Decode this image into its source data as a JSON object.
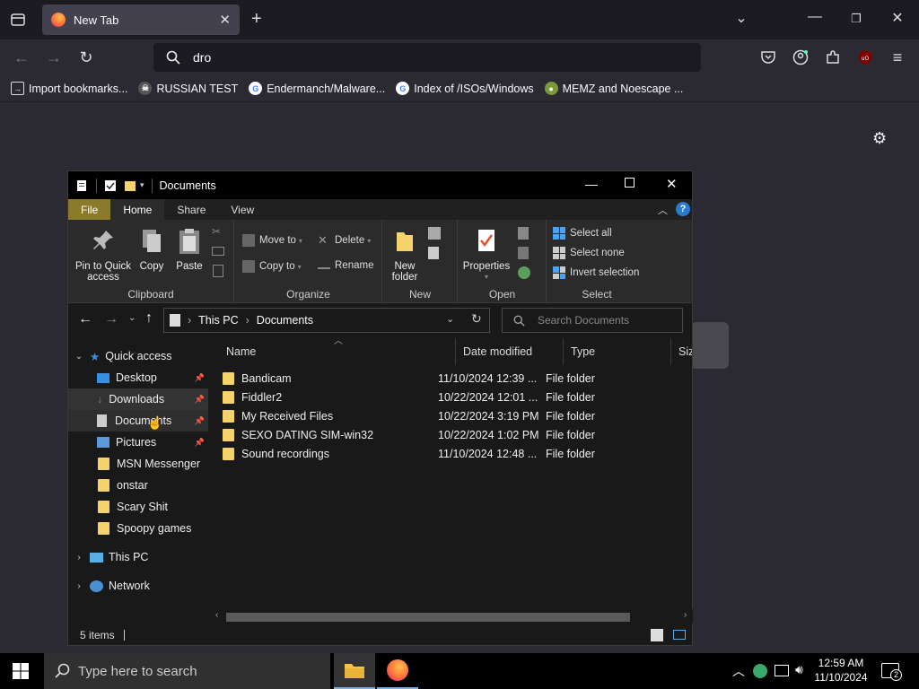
{
  "browser": {
    "tab_title": "New Tab",
    "url_text": "dro",
    "bookmarks": [
      "Import bookmarks...",
      "RUSSIAN TEST",
      "Endermanch/Malware...",
      "Index of /ISOs/Windows",
      "MEMZ and Noescape ..."
    ]
  },
  "explorer": {
    "title": "Documents",
    "ribbon_tabs": [
      "File",
      "Home",
      "Share",
      "View"
    ],
    "clipboard": {
      "pin": "Pin to Quick access",
      "copy": "Copy",
      "paste": "Paste",
      "label": "Clipboard"
    },
    "organize": {
      "move_to": "Move to",
      "copy_to": "Copy to",
      "delete": "Delete",
      "rename": "Rename",
      "label": "Organize"
    },
    "new": {
      "new_folder": "New folder",
      "label": "New"
    },
    "open": {
      "properties": "Properties",
      "label": "Open"
    },
    "select": {
      "select_all": "Select all",
      "select_none": "Select none",
      "invert": "Invert selection",
      "label": "Select"
    },
    "breadcrumb": [
      "This PC",
      "Documents"
    ],
    "search_placeholder": "Search Documents",
    "nav": {
      "quick_access": "Quick access",
      "items": [
        "Desktop",
        "Downloads",
        "Documents",
        "Pictures",
        "MSN Messenger",
        "onstar",
        "Scary Shit",
        "Spoopy games"
      ],
      "this_pc": "This PC",
      "network": "Network"
    },
    "columns": [
      "Name",
      "Date modified",
      "Type",
      "Size"
    ],
    "files": [
      {
        "name": "Bandicam",
        "date": "11/10/2024 12:39 ...",
        "type": "File folder"
      },
      {
        "name": "Fiddler2",
        "date": "10/22/2024 12:01 ...",
        "type": "File folder"
      },
      {
        "name": "My Received Files",
        "date": "10/22/2024 3:19 PM",
        "type": "File folder"
      },
      {
        "name": "SEXO DATING SIM-win32",
        "date": "10/22/2024 1:02 PM",
        "type": "File folder"
      },
      {
        "name": "Sound recordings",
        "date": "11/10/2024 12:48 ...",
        "type": "File folder"
      }
    ],
    "status": "5 items"
  },
  "taskbar": {
    "search_placeholder": "Type here to search",
    "time": "12:59 AM",
    "date": "11/10/2024",
    "notification_count": "2"
  }
}
